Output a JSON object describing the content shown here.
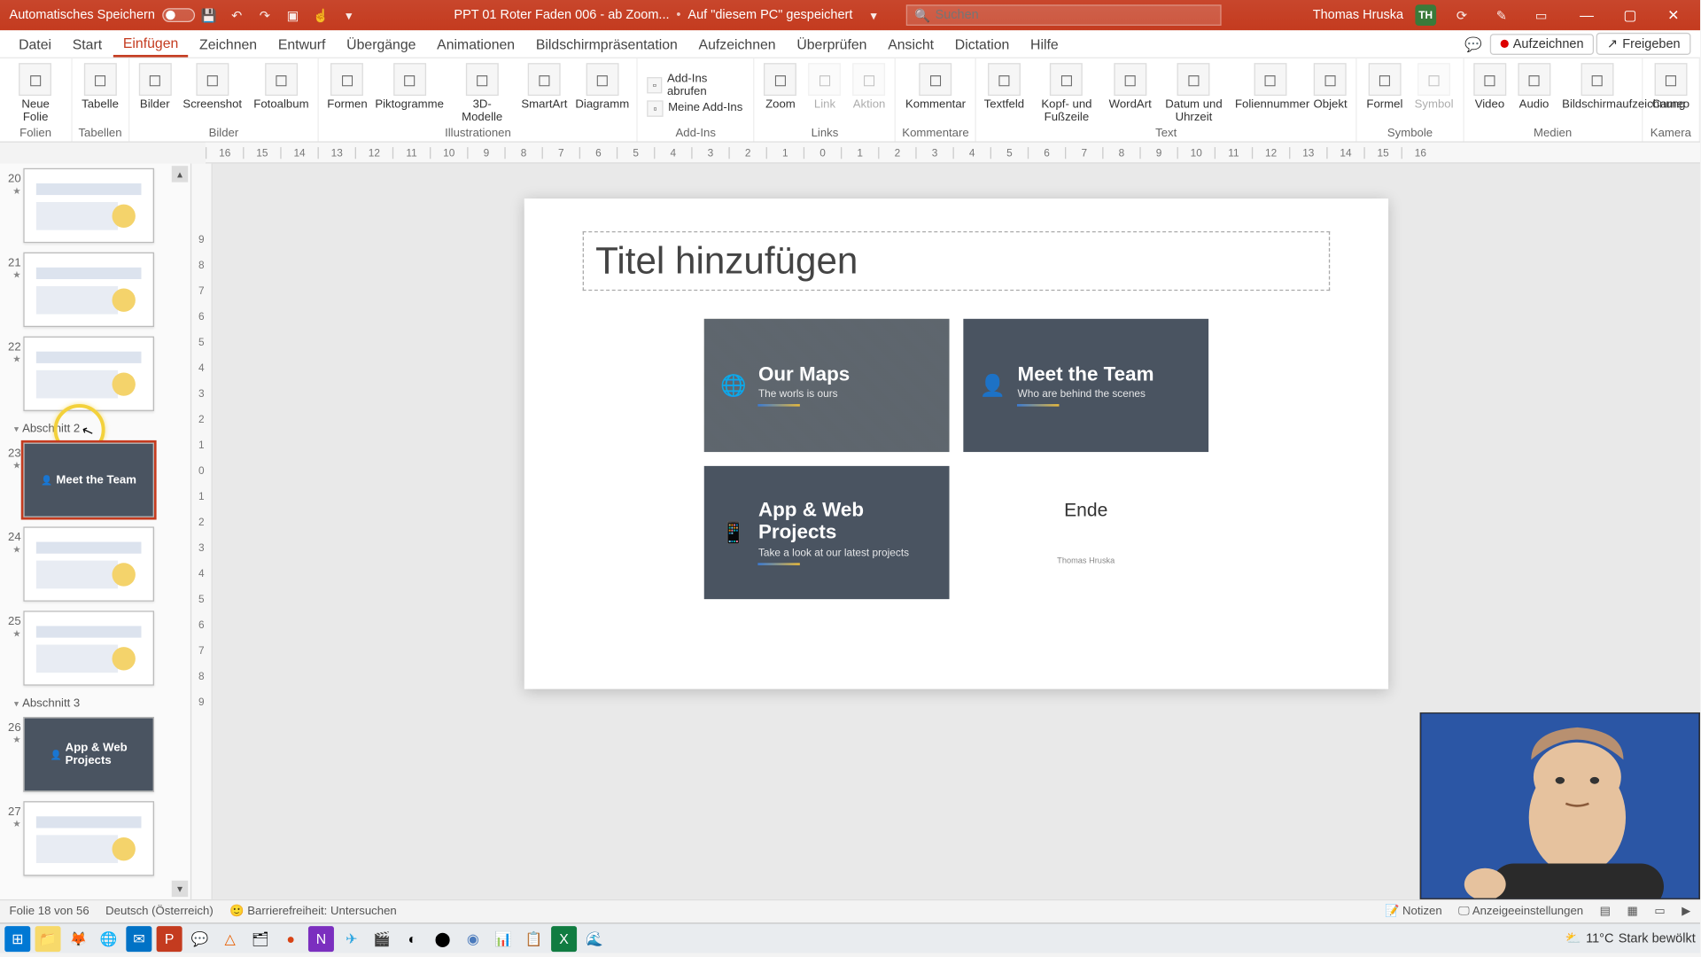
{
  "titlebar": {
    "autosave": "Automatisches Speichern",
    "filename": "PPT 01 Roter Faden 006 - ab Zoom...",
    "saved_state": "Auf \"diesem PC\" gespeichert",
    "search_placeholder": "Suchen",
    "user_name": "Thomas Hruska",
    "user_initials": "TH"
  },
  "menu": {
    "items": [
      "Datei",
      "Start",
      "Einfügen",
      "Zeichnen",
      "Entwurf",
      "Übergänge",
      "Animationen",
      "Bildschirmpräsentation",
      "Aufzeichnen",
      "Überprüfen",
      "Ansicht",
      "Dictation",
      "Hilfe"
    ],
    "active": 2,
    "record": "Aufzeichnen",
    "share": "Freigeben"
  },
  "ribbon": {
    "groups": [
      {
        "label": "Folien",
        "items": [
          {
            "lbl": "Neue\nFolie"
          }
        ]
      },
      {
        "label": "Tabellen",
        "items": [
          {
            "lbl": "Tabelle"
          }
        ]
      },
      {
        "label": "Bilder",
        "items": [
          {
            "lbl": "Bilder"
          },
          {
            "lbl": "Screenshot"
          },
          {
            "lbl": "Fotoalbum"
          }
        ]
      },
      {
        "label": "Illustrationen",
        "items": [
          {
            "lbl": "Formen"
          },
          {
            "lbl": "Piktogramme"
          },
          {
            "lbl": "3D-\nModelle"
          },
          {
            "lbl": "SmartArt"
          },
          {
            "lbl": "Diagramm"
          }
        ]
      },
      {
        "label": "Add-Ins",
        "small": [
          {
            "lbl": "Add-Ins abrufen"
          },
          {
            "lbl": "Meine Add-Ins"
          }
        ]
      },
      {
        "label": "Links",
        "items": [
          {
            "lbl": "Zoom"
          },
          {
            "lbl": "Link",
            "dim": true
          },
          {
            "lbl": "Aktion",
            "dim": true
          }
        ]
      },
      {
        "label": "Kommentare",
        "items": [
          {
            "lbl": "Kommentar"
          }
        ]
      },
      {
        "label": "Text",
        "items": [
          {
            "lbl": "Textfeld"
          },
          {
            "lbl": "Kopf- und\nFußzeile"
          },
          {
            "lbl": "WordArt"
          },
          {
            "lbl": "Datum und\nUhrzeit"
          },
          {
            "lbl": "Foliennummer"
          },
          {
            "lbl": "Objekt"
          }
        ]
      },
      {
        "label": "Symbole",
        "items": [
          {
            "lbl": "Formel"
          },
          {
            "lbl": "Symbol",
            "dim": true
          }
        ]
      },
      {
        "label": "Medien",
        "items": [
          {
            "lbl": "Video"
          },
          {
            "lbl": "Audio"
          },
          {
            "lbl": "Bildschirmaufzeichnung"
          }
        ]
      },
      {
        "label": "Kamera",
        "items": [
          {
            "lbl": "Cameo"
          }
        ]
      }
    ]
  },
  "ruler_h": [
    "16",
    "15",
    "14",
    "13",
    "12",
    "11",
    "10",
    "9",
    "8",
    "7",
    "6",
    "5",
    "4",
    "3",
    "2",
    "1",
    "0",
    "1",
    "2",
    "3",
    "4",
    "5",
    "6",
    "7",
    "8",
    "9",
    "10",
    "11",
    "12",
    "13",
    "14",
    "15",
    "16"
  ],
  "ruler_v": [
    "9",
    "8",
    "7",
    "6",
    "5",
    "4",
    "3",
    "2",
    "1",
    "0",
    "1",
    "2",
    "3",
    "4",
    "5",
    "6",
    "7",
    "8",
    "9"
  ],
  "sections": {
    "s2": "Abschnitt 2",
    "s3": "Abschnitt 3"
  },
  "thumbs": [
    {
      "num": "20",
      "kind": "light"
    },
    {
      "num": "21",
      "kind": "light"
    },
    {
      "num": "22",
      "kind": "light"
    },
    {
      "num": "23",
      "kind": "dark",
      "title": "Meet the Team",
      "selected": true
    },
    {
      "num": "24",
      "kind": "light"
    },
    {
      "num": "25",
      "kind": "light"
    },
    {
      "num": "26",
      "kind": "dark",
      "title": "App & Web",
      "sub": "Projects"
    },
    {
      "num": "27",
      "kind": "light"
    }
  ],
  "slide": {
    "title_placeholder": "Titel hinzufügen",
    "cards": {
      "0": {
        "title": "Our Maps",
        "sub": "The worls is ours"
      },
      "1": {
        "title": "Meet the Team",
        "sub": "Who are behind the scenes"
      },
      "2": {
        "title": "App & Web Projects",
        "sub": "Take a look at our latest projects"
      },
      "3": {
        "title": "Ende",
        "sub": "Thomas Hruska"
      }
    }
  },
  "status": {
    "slide_of": "Folie 18 von 56",
    "lang": "Deutsch (Österreich)",
    "access": "Barrierefreiheit: Untersuchen",
    "notes": "Notizen",
    "display": "Anzeigeeinstellungen"
  },
  "taskbar": {
    "weather_temp": "11°C",
    "weather_text": "Stark bewölkt"
  }
}
